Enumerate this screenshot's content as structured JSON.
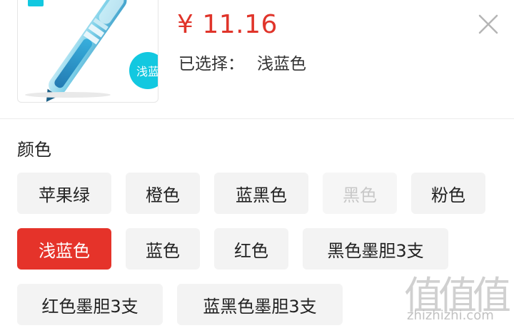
{
  "product": {
    "price": "¥ 11.16",
    "selected_label": "已选择：",
    "selected_value": "浅蓝色",
    "thumbnail_badge": "浅蓝"
  },
  "options": {
    "title": "颜色",
    "chips": [
      {
        "label": "苹果绿",
        "state": "normal"
      },
      {
        "label": "橙色",
        "state": "normal"
      },
      {
        "label": "蓝黑色",
        "state": "normal"
      },
      {
        "label": "黑色",
        "state": "disabled"
      },
      {
        "label": "粉色",
        "state": "normal"
      },
      {
        "label": "浅蓝色",
        "state": "selected"
      },
      {
        "label": "蓝色",
        "state": "normal"
      },
      {
        "label": "红色",
        "state": "normal"
      },
      {
        "label": "黑色墨胆3支",
        "state": "normal"
      },
      {
        "label": "红色墨胆3支",
        "state": "normal"
      },
      {
        "label": "蓝黑色墨胆3支",
        "state": "normal"
      }
    ]
  },
  "watermark": {
    "chars": "值值值",
    "url": "zhizhizhi.com"
  },
  "colors": {
    "price": "#e0342a",
    "selected_chip": "#e5332a",
    "chip_bg": "#f3f3f3",
    "badge": "#12c8e0"
  },
  "icons": {
    "close": "close-icon"
  }
}
